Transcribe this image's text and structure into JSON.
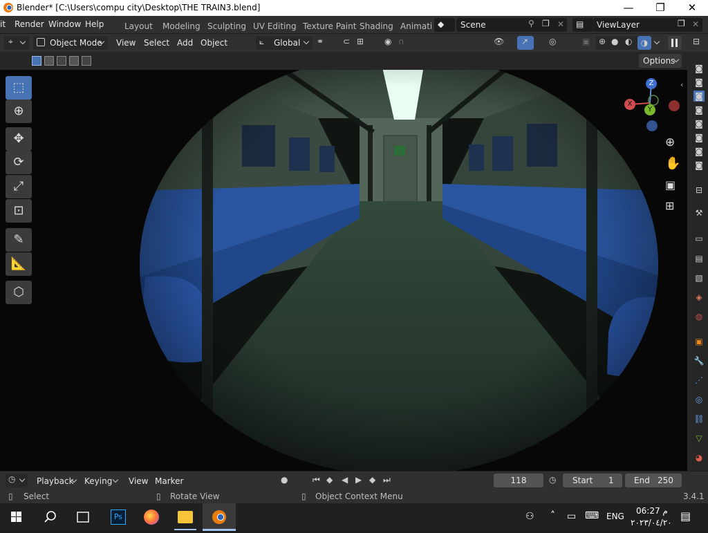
{
  "window": {
    "title": "Blender* [C:\\Users\\compu city\\Desktop\\THE TRAIN3.blend]",
    "minimize": "—",
    "maximize": "❐",
    "close": "✕"
  },
  "menu": {
    "items": [
      "it",
      "Render",
      "Window",
      "Help"
    ]
  },
  "workspaces": [
    "Layout",
    "Modeling",
    "Sculpting",
    "UV Editing",
    "Texture Paint",
    "Shading",
    "Animati"
  ],
  "scene": {
    "name": "Scene",
    "view_layer": "ViewLayer"
  },
  "header": {
    "mode": "Object Mode",
    "menus": [
      "View",
      "Select",
      "Add",
      "Object"
    ],
    "orientation": "Global"
  },
  "toolbar": {
    "options": "Options"
  },
  "gizmo": {
    "z": "Z",
    "x": "X",
    "y": "Y"
  },
  "timeline": {
    "items": [
      "Playback",
      "Keying",
      "View",
      "Marker"
    ],
    "current_frame": "118",
    "start_label": "Start",
    "start_value": "1",
    "end_label": "End",
    "end_value": "250"
  },
  "status": {
    "select": "Select",
    "rotate": "Rotate View",
    "context": "Object Context Menu",
    "version": "3.4.1"
  },
  "taskbar": {
    "lang": "ENG",
    "time": "06:27 م",
    "date": "٢٠٢٣/٠٤/٢٠"
  },
  "colors": {
    "accent": "#4772b3",
    "seat": "#2b5aa8",
    "floor": "#34463a",
    "header": "#303030"
  }
}
